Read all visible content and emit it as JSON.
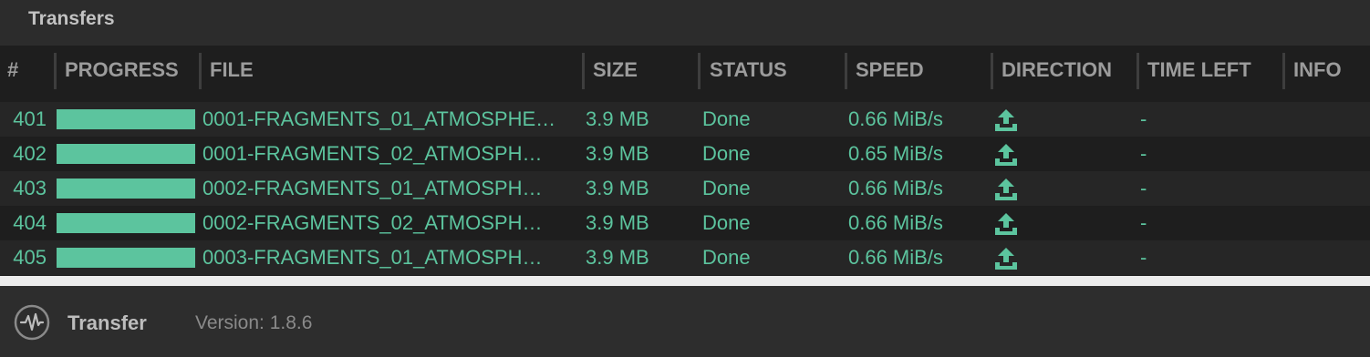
{
  "panel": {
    "title": "Transfers"
  },
  "columns": {
    "num": "#",
    "progress": "PROGRESS",
    "file": "FILE",
    "size": "SIZE",
    "status": "STATUS",
    "speed": "SPEED",
    "direction": "DIRECTION",
    "time_left": "TIME LEFT",
    "info": "INFO"
  },
  "rows": [
    {
      "num": "401",
      "progress": 1.0,
      "file": "0001-FRAGMENTS_01_ATMOSPHE…",
      "size": "3.9 MB",
      "status": "Done",
      "speed": "0.66 MiB/s",
      "direction": "upload-icon",
      "time_left": "-"
    },
    {
      "num": "402",
      "progress": 1.0,
      "file": "0001-FRAGMENTS_02_ATMOSPH…",
      "size": "3.9 MB",
      "status": "Done",
      "speed": "0.65 MiB/s",
      "direction": "upload-icon",
      "time_left": "-"
    },
    {
      "num": "403",
      "progress": 1.0,
      "file": "0002-FRAGMENTS_01_ATMOSPH…",
      "size": "3.9 MB",
      "status": "Done",
      "speed": "0.66 MiB/s",
      "direction": "upload-icon",
      "time_left": "-"
    },
    {
      "num": "404",
      "progress": 1.0,
      "file": "0002-FRAGMENTS_02_ATMOSPH…",
      "size": "3.9 MB",
      "status": "Done",
      "speed": "0.66 MiB/s",
      "direction": "upload-icon",
      "time_left": "-"
    },
    {
      "num": "405",
      "progress": 1.0,
      "file": "0003-FRAGMENTS_01_ATMOSPH…",
      "size": "3.9 MB",
      "status": "Done",
      "speed": "0.66 MiB/s",
      "direction": "upload-icon",
      "time_left": "-"
    }
  ],
  "footer": {
    "logo_icon": "waveform-circle-icon",
    "app_name": "Transfer",
    "version": "Version: 1.8.6"
  },
  "colors": {
    "accent": "#5cc49e",
    "header_text": "#9c9c9c",
    "background": "#1e1e1e"
  }
}
